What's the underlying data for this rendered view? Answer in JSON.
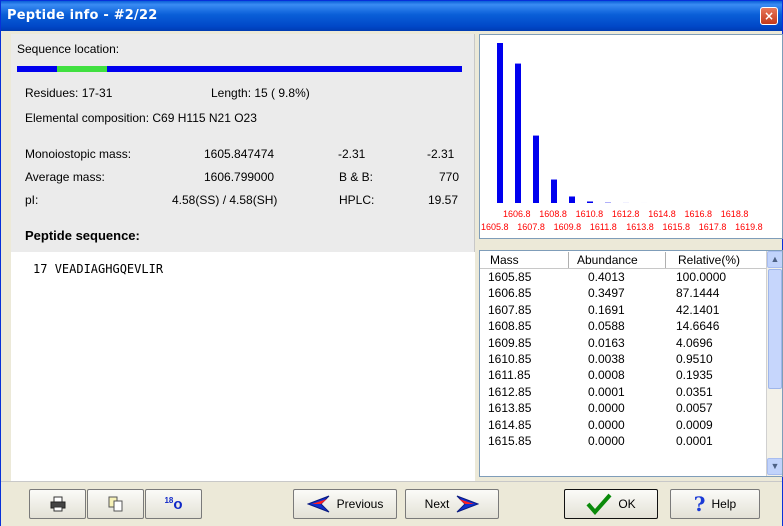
{
  "window": {
    "title": "Peptide info - #2/22",
    "close_glyph": "×"
  },
  "info": {
    "sequence_location_label": "Sequence location:",
    "residues": "Residues: 17-31",
    "length": "Length: 15 ( 9.8%)",
    "elemental_composition": "Elemental composition:  C69 H115 N21 O23",
    "mono_label": "Monoiostopic mass:",
    "mono_value": "1605.847474",
    "mono_extra1": "-2.31",
    "mono_extra2": "-2.31",
    "avg_label": "Average mass:",
    "avg_value": "1606.799000",
    "bb_label": "B & B:",
    "bb_value": "770",
    "pi_label": "pI:",
    "pi_value": "4.58(SS) / 4.58(SH)",
    "hplc_label": "HPLC:",
    "hplc_value": "19.57",
    "peptide_sequence_label": "Peptide sequence:",
    "sequence_start": "17",
    "sequence": "VEADIAGHGQEVLIR",
    "location_fraction_start": 0.09,
    "location_fraction_end": 0.2
  },
  "chart_data": {
    "type": "bar",
    "values": [
      100.0,
      87.1444,
      42.1401,
      14.6646,
      4.0696,
      0.951,
      0.1935,
      0.0351,
      0.0057,
      0.0009
    ],
    "x": [
      1605.85,
      1606.85,
      1607.85,
      1608.85,
      1609.85,
      1610.85,
      1611.85,
      1612.85,
      1613.85,
      1614.85
    ],
    "label_row_top": [
      "1606.8",
      "1608.8",
      "1610.8",
      "1612.8",
      "1614.8",
      "1616.8",
      "1618.8"
    ],
    "label_row_bottom": [
      "1605.8",
      "1607.8",
      "1609.8",
      "1611.8",
      "1613.8",
      "1615.8",
      "1617.8",
      "1619.8"
    ],
    "bar_color": "#0000ee",
    "label_color": "#ff0000"
  },
  "table": {
    "headers": [
      "Mass",
      "Abundance",
      "Relative(%)"
    ],
    "rows": [
      [
        "1605.85",
        "0.4013",
        "100.0000"
      ],
      [
        "1606.85",
        "0.3497",
        "87.1444"
      ],
      [
        "1607.85",
        "0.1691",
        "42.1401"
      ],
      [
        "1608.85",
        "0.0588",
        "14.6646"
      ],
      [
        "1609.85",
        "0.0163",
        "4.0696"
      ],
      [
        "1610.85",
        "0.0038",
        "0.9510"
      ],
      [
        "1611.85",
        "0.0008",
        "0.1935"
      ],
      [
        "1612.85",
        "0.0001",
        "0.0351"
      ],
      [
        "1613.85",
        "0.0000",
        "0.0057"
      ],
      [
        "1614.85",
        "0.0000",
        "0.0009"
      ],
      [
        "1615.85",
        "0.0000",
        "0.0001"
      ]
    ]
  },
  "buttons": {
    "print_icon": "printer-icon",
    "copy_icon": "copy-icon",
    "isotope_icon": "isotope-18o-icon",
    "isotope_superscript": "18",
    "isotope_letter": "o",
    "previous": "Previous",
    "next": "Next",
    "ok": "OK",
    "help": "Help"
  }
}
